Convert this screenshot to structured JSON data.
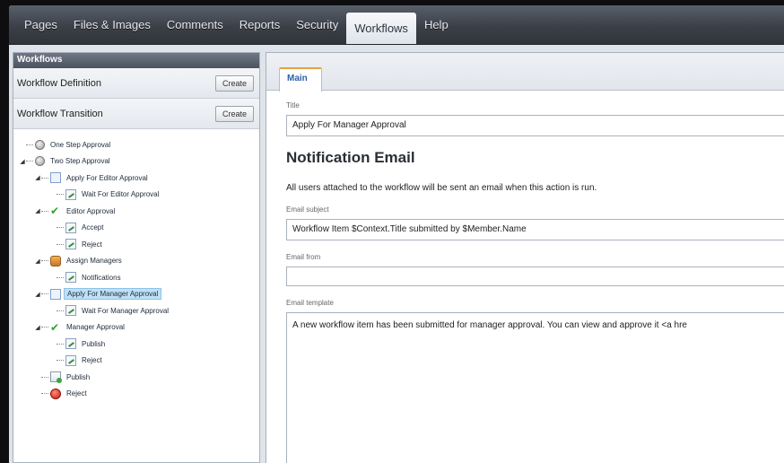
{
  "nav": {
    "items": [
      {
        "label": "Pages",
        "active": false
      },
      {
        "label": "Files & Images",
        "active": false
      },
      {
        "label": "Comments",
        "active": false
      },
      {
        "label": "Reports",
        "active": false
      },
      {
        "label": "Security",
        "active": false
      },
      {
        "label": "Workflows",
        "active": true
      },
      {
        "label": "Help",
        "active": false
      }
    ]
  },
  "sidebar": {
    "header": "Workflows",
    "rows": [
      {
        "label": "Workflow Definition",
        "button": "Create"
      },
      {
        "label": "Workflow Transition",
        "button": "Create"
      }
    ],
    "tree": [
      {
        "label": "One Step Approval",
        "icon": "gear-icon",
        "depth": 0,
        "expander": "",
        "selected": false
      },
      {
        "label": "Two Step Approval",
        "icon": "gear-icon",
        "depth": 0,
        "expander": "◢",
        "selected": false
      },
      {
        "label": "Apply For Editor Approval",
        "icon": "page-icon",
        "depth": 1,
        "expander": "◢",
        "selected": false
      },
      {
        "label": "Wait For Editor Approval",
        "icon": "wait-icon",
        "depth": 2,
        "expander": "",
        "selected": false
      },
      {
        "label": "Editor Approval",
        "icon": "check-icon",
        "depth": 1,
        "expander": "◢",
        "selected": false
      },
      {
        "label": "Accept",
        "icon": "wait-icon",
        "depth": 2,
        "expander": "",
        "selected": false
      },
      {
        "label": "Reject",
        "icon": "wait-icon",
        "depth": 2,
        "expander": "",
        "selected": false
      },
      {
        "label": "Assign Managers",
        "icon": "people-icon",
        "depth": 1,
        "expander": "◢",
        "selected": false
      },
      {
        "label": "Notifications",
        "icon": "wait-icon",
        "depth": 2,
        "expander": "",
        "selected": false
      },
      {
        "label": "Apply For Manager Approval",
        "icon": "page-icon",
        "depth": 1,
        "expander": "◢",
        "selected": true
      },
      {
        "label": "Wait For Manager Approval",
        "icon": "wait-icon",
        "depth": 2,
        "expander": "",
        "selected": false
      },
      {
        "label": "Manager Approval",
        "icon": "check-icon",
        "depth": 1,
        "expander": "◢",
        "selected": false
      },
      {
        "label": "Publish",
        "icon": "wait-icon",
        "depth": 2,
        "expander": "",
        "selected": false
      },
      {
        "label": "Reject",
        "icon": "wait-icon",
        "depth": 2,
        "expander": "",
        "selected": false
      },
      {
        "label": "Publish",
        "icon": "publish-icon",
        "depth": 1,
        "expander": "",
        "selected": false
      },
      {
        "label": "Reject",
        "icon": "reject-icon",
        "depth": 1,
        "expander": "",
        "selected": false
      }
    ]
  },
  "main": {
    "tab": "Main",
    "title_label": "Title",
    "title_value": "Apply For Manager Approval",
    "section_title": "Notification Email",
    "description": "All users attached to the workflow will be sent an email when this action is run.",
    "subject_label": "Email subject",
    "subject_value": "Workflow Item $Context.Title submitted by $Member.Name",
    "from_label": "Email from",
    "from_value": "",
    "template_label": "Email template",
    "template_value": "A new workflow item has been submitted for manager approval. You can view and approve it <a hre"
  }
}
